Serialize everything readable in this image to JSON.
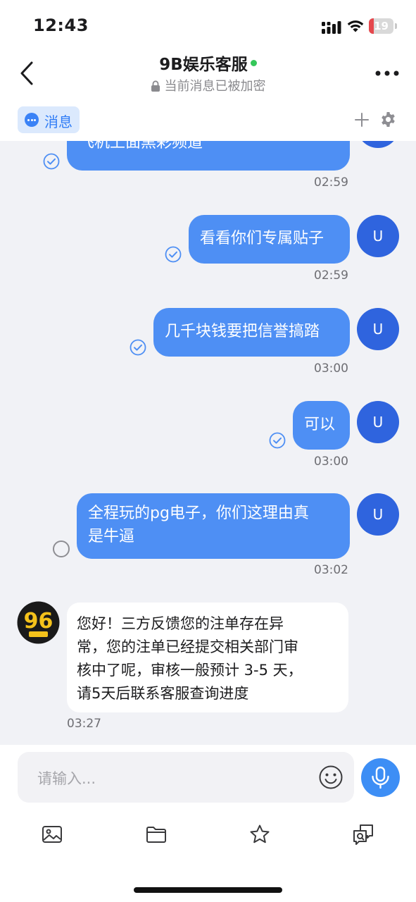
{
  "status_bar": {
    "time": "12:43",
    "battery_level": "19",
    "battery_fraction": 0.19
  },
  "header": {
    "title": "9B娱乐客服",
    "subtitle": "当前消息已被加密"
  },
  "tabs": {
    "active_label": "消息"
  },
  "chat": {
    "messages": [
      {
        "side": "out",
        "text": "飞机上面黑彩频道",
        "time": "02:59",
        "status": "delivered"
      },
      {
        "side": "out",
        "text": "看看你们专属贴子",
        "time": "02:59",
        "status": "delivered",
        "avatar": "U"
      },
      {
        "side": "out",
        "text": "几千块钱要把信誉搞踏",
        "time": "03:00",
        "status": "delivered",
        "avatar": "U"
      },
      {
        "side": "out",
        "text": "可以",
        "time": "03:00",
        "status": "delivered",
        "avatar": "U"
      },
      {
        "side": "out",
        "text_line1": "全程玩的pg电子，你们这理由真",
        "text_line2": "是牛逼",
        "time": "03:02",
        "status": "pending",
        "avatar": "U"
      },
      {
        "side": "in",
        "line1": "您好！三方反馈您的注单存在异",
        "line2": "常，您的注单已经提交相关部门审",
        "line3": "核中了呢，审核一般预计 3-5 天，",
        "line4": "请5天后联系客服查询进度",
        "time": "03:27",
        "avatar_text": "96"
      }
    ]
  },
  "input": {
    "placeholder": "请输入..."
  },
  "colors": {
    "accent": "#3d8ef5",
    "outgoing_bubble": "#4e8ff4",
    "user_avatar": "#2f64de",
    "online": "#34c759",
    "chat_bg": "#f1f2f6"
  },
  "icons": [
    "back-chevron-icon",
    "lock-icon",
    "more-icon",
    "chat-bubble-icon",
    "plus-icon",
    "gear-icon",
    "check-circle-icon",
    "emoji-icon",
    "microphone-icon",
    "image-icon",
    "folder-icon",
    "star-icon",
    "chat-translate-icon"
  ]
}
